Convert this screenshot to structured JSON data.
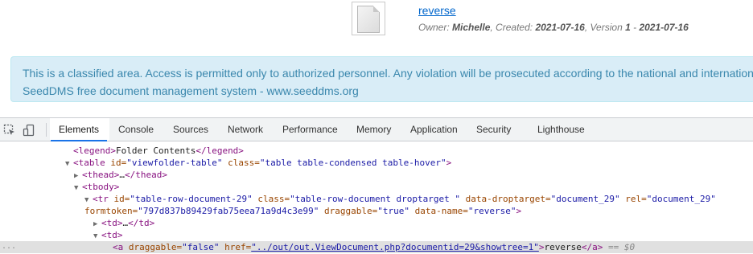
{
  "document": {
    "name": "reverse",
    "owner_label": "Owner:",
    "owner": "Michelle",
    "created_label": ", Created:",
    "created": "2021-07-16",
    "version_label": ", Version",
    "version": "1",
    "version_sep": " - ",
    "version_date": "2021-07-16"
  },
  "alert": {
    "line1": "This is a classified area. Access is permitted only to authorized personnel. Any violation will be prosecuted according to the national and international laws.",
    "line2": "SeedDMS free document management system - www.seeddms.org"
  },
  "devtools": {
    "tabs": [
      "Elements",
      "Console",
      "Sources",
      "Network",
      "Performance",
      "Memory",
      "Application",
      "Security",
      "Lighthouse"
    ],
    "active_tab": "Elements",
    "icons": [
      "inspect-icon",
      "device-toolbar-icon"
    ],
    "code": {
      "l1": {
        "tag_open": "<legend>",
        "text": "Folder Contents",
        "tag_close": "</legend>"
      },
      "l2": {
        "tag": "<table",
        "a1": " id=",
        "v1": "\"viewfolder-table\"",
        "a2": " class=",
        "v2": "\"table table-condensed table-hover\"",
        "end": ">"
      },
      "l3": {
        "tag_open": "<thead>",
        "ellipsis": "…",
        "tag_close": "</thead>"
      },
      "l4": {
        "tag_open": "<tbody>"
      },
      "l5": {
        "tag": "<tr",
        "a1": " id=",
        "v1": "\"table-row-document-29\"",
        "a2": " class=",
        "v2": "\"table-row-document droptarget \"",
        "a3": " data-droptarget=",
        "v3": "\"document_29\"",
        "a4": " rel=",
        "v4": "\"document_29\""
      },
      "l6": {
        "a1": "formtoken=",
        "v1": "\"797d837b89429fab75eea71a9d4c3e99\"",
        "a2": " draggable=",
        "v2": "\"true\"",
        "a3": " data-name=",
        "v3": "\"reverse\"",
        "end": ">"
      },
      "l7": {
        "tag_open": "<td>",
        "ellipsis": "…",
        "tag_close": "</td>"
      },
      "l8": {
        "tag_open": "<td>"
      },
      "l9": {
        "tag": "<a",
        "a1": " draggable=",
        "v1": "\"false\"",
        "a2": " href=",
        "v2": "\"../out/out.ViewDocument.php?documentid=29&showtree=1\"",
        "end": ">",
        "text": "reverse",
        "tag_close": "</a>",
        "eq": " == ",
        "dollar": "$0"
      }
    },
    "gutter_dots": "..."
  }
}
